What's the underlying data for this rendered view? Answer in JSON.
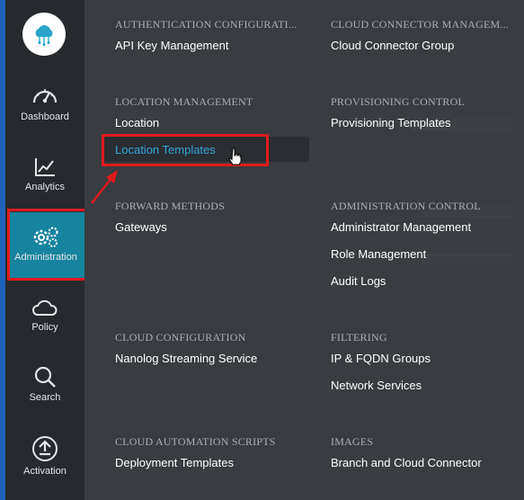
{
  "sidebar": {
    "items": [
      {
        "label": "Dashboard",
        "icon": "gauge-icon"
      },
      {
        "label": "Analytics",
        "icon": "chart-icon"
      },
      {
        "label": "Administration",
        "icon": "gears-icon",
        "active": true
      },
      {
        "label": "Policy",
        "icon": "cloud-icon"
      },
      {
        "label": "Search",
        "icon": "search-icon"
      },
      {
        "label": "Activation",
        "icon": "upload-icon"
      }
    ]
  },
  "menu": {
    "sections": [
      {
        "title": "AUTHENTICATION CONFIGURATI...",
        "items": [
          "API Key Management"
        ]
      },
      {
        "title": "CLOUD CONNECTOR MANAGEM...",
        "items": [
          "Cloud Connector Group"
        ]
      },
      {
        "title": "LOCATION MANAGEMENT",
        "items": [
          "Location",
          "Location Templates"
        ]
      },
      {
        "title": "PROVISIONING CONTROL",
        "items": [
          "Provisioning Templates"
        ]
      },
      {
        "title": "FORWARD METHODS",
        "items": [
          "Gateways"
        ]
      },
      {
        "title": "ADMINISTRATION CONTROL",
        "items": [
          "Administrator Management",
          "Role Management",
          "Audit Logs"
        ]
      },
      {
        "title": "CLOUD CONFIGURATION",
        "items": [
          "Nanolog Streaming Service"
        ]
      },
      {
        "title": "FILTERING",
        "items": [
          "IP & FQDN Groups",
          "Network Services"
        ]
      },
      {
        "title": "CLOUD AUTOMATION SCRIPTS",
        "items": [
          "Deployment Templates"
        ]
      },
      {
        "title": "IMAGES",
        "items": [
          "Branch and Cloud Connector"
        ]
      }
    ],
    "highlighted_item": "Location Templates"
  },
  "colors": {
    "accent": "#16849f",
    "highlight_text": "#31a6d6",
    "annotation_red": "#e01a1f"
  }
}
